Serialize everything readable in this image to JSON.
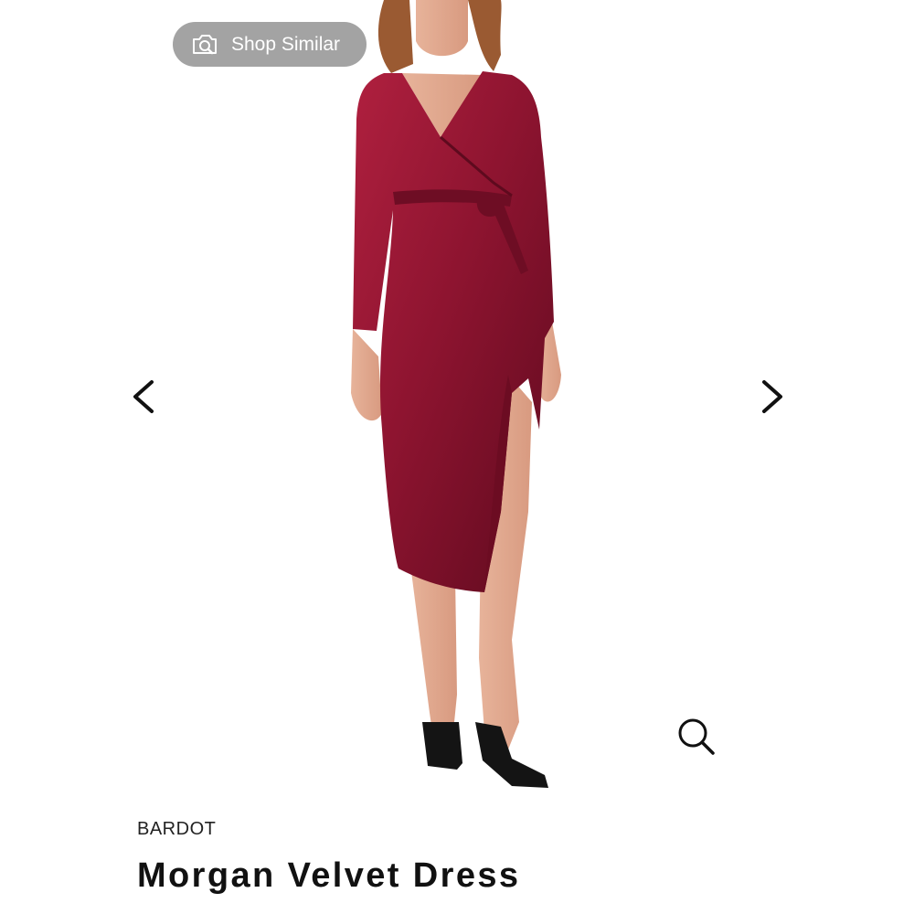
{
  "shop_similar": {
    "label": "Shop Similar",
    "icon": "camera-search-icon"
  },
  "carousel": {
    "prev_icon": "chevron-left-icon",
    "next_icon": "chevron-right-icon",
    "zoom_icon": "magnify-icon"
  },
  "product": {
    "brand": "BARDOT",
    "name": "Morgan Velvet Dress"
  },
  "colors": {
    "dress": "#8e1430",
    "pill_background": "#a3a3a3",
    "text": "#111111"
  }
}
